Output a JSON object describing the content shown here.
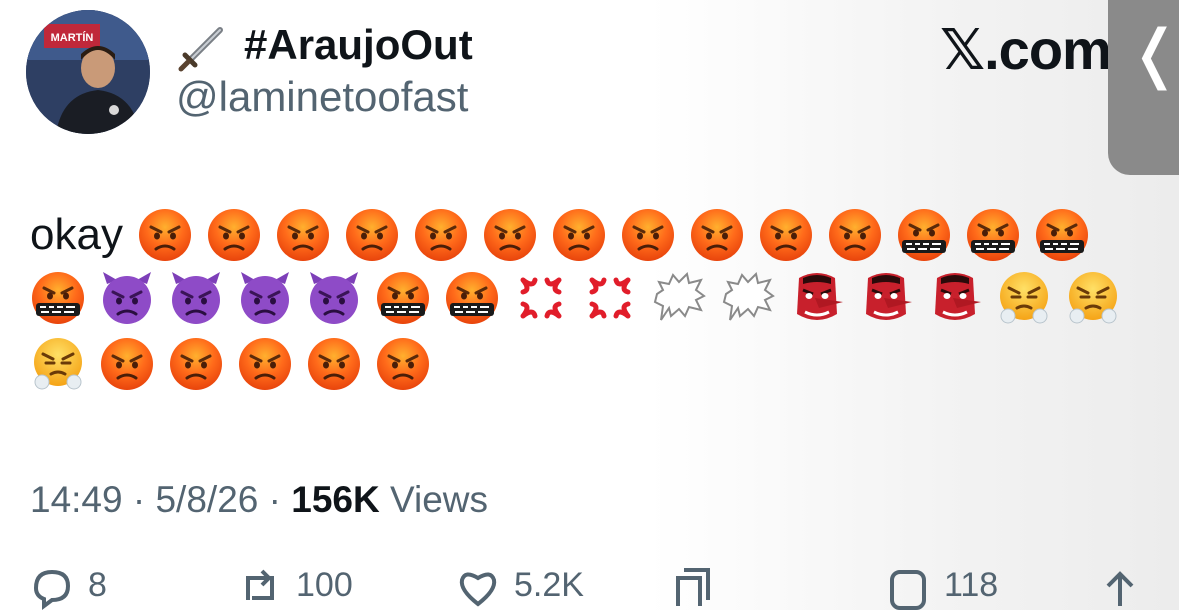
{
  "author": {
    "display_name": "#AraujoOut",
    "handle": "@laminetoofast",
    "avatar_caption": "MARTÍN"
  },
  "source": {
    "label": "𝕏.com"
  },
  "tweet": {
    "text": "okay",
    "emoji_rows": [
      [
        "angry",
        "angry",
        "angry",
        "angry",
        "angry",
        "angry",
        "angry",
        "angry",
        "angry",
        "angry",
        "angry",
        "cursing",
        "cursing",
        "cursing"
      ],
      [
        "cursing",
        "imp",
        "imp",
        "imp",
        "imp",
        "cursing",
        "cursing",
        "anger-symbol",
        "anger-symbol",
        "speech-bubble",
        "speech-bubble",
        "goblin",
        "goblin",
        "goblin",
        "triumph",
        "triumph"
      ],
      [
        "triumph",
        "angry",
        "angry",
        "angry",
        "angry",
        "angry"
      ]
    ]
  },
  "meta": {
    "time": "14:49",
    "separator": "·",
    "date": "5/8/26",
    "views_count": "156K",
    "views_label": "Views"
  },
  "actions": {
    "replies": "8",
    "reposts": "100",
    "likes": "5.2K",
    "bookmarks": "118"
  },
  "colors": {
    "text": "#0f1419",
    "muted": "#536471",
    "side_tab": "#8a8a8a"
  }
}
